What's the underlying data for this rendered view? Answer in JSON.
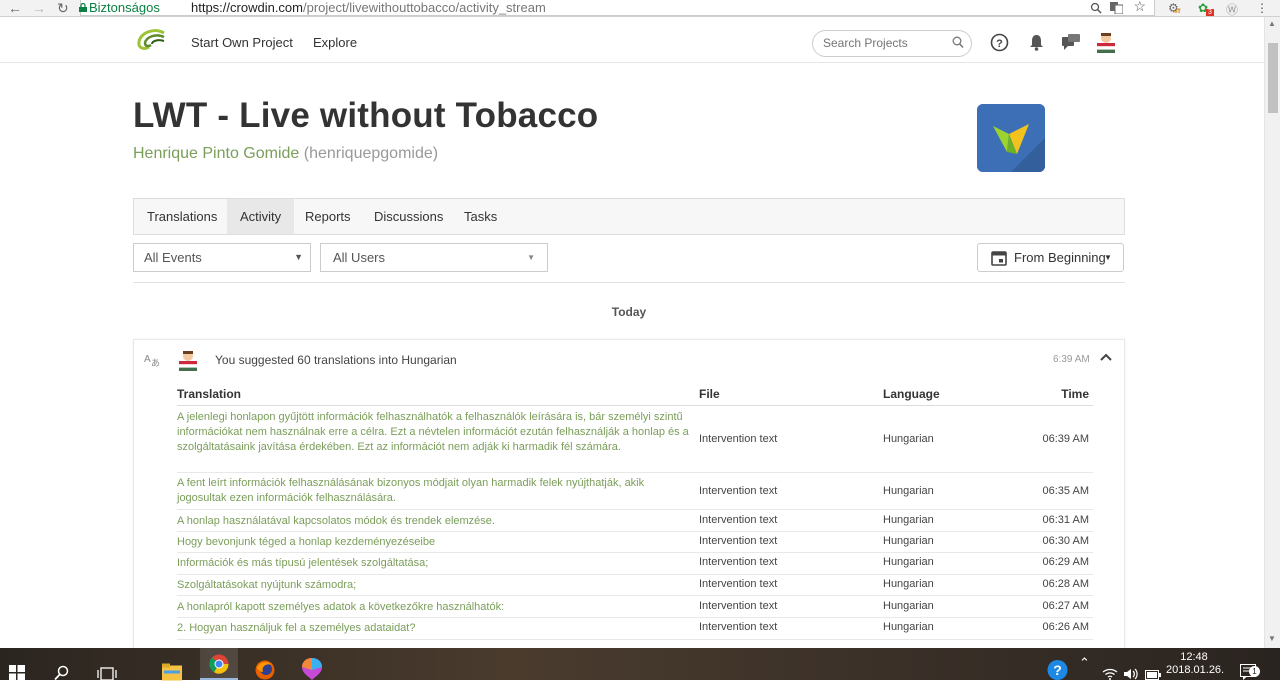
{
  "browser": {
    "back": "←",
    "forward": "→",
    "reload": "↻",
    "secure_label": "Biztonságos",
    "url_host": "https://crowdin.com",
    "url_path": "/project/livewithouttobacco/activity_stream",
    "ext_off": "off",
    "ext_badge": "3"
  },
  "header": {
    "nav": [
      "Start Own Project",
      "Explore"
    ],
    "search_placeholder": "Search Projects"
  },
  "project": {
    "title": "LWT - Live without Tobacco",
    "owner_name": "Henrique Pinto Gomide",
    "owner_login": "(henriquepgomide)"
  },
  "tabs": [
    "Translations",
    "Activity",
    "Reports",
    "Discussions",
    "Tasks"
  ],
  "active_tab": "Activity",
  "filters": {
    "events": "All Events",
    "users": "All Users",
    "date": "From Beginning"
  },
  "day_heading": "Today",
  "event": {
    "text": "You suggested 60 translations into Hungarian",
    "time": "6:39 AM"
  },
  "table": {
    "headers": [
      "Translation",
      "File",
      "Language",
      "Time"
    ],
    "rows": [
      {
        "translation": "A jelenlegi honlapon gyűjtött információk felhasználhatók a felhasználók leírására is, bár személyi szintű információkat nem használnak erre a célra. Ezt a névtelen információt ezután felhasználják a honlap és a szolgáltatásaink javítása érdekében. Ezt az információt nem adják ki harmadik fél számára.",
        "file": "Intervention text",
        "language": "Hungarian",
        "time": "06:39 AM"
      },
      {
        "translation": "A fent leírt információk felhasználásának bizonyos módjait olyan harmadik felek nyújthatják, akik jogosultak ezen információk felhasználására.",
        "file": "Intervention text",
        "language": "Hungarian",
        "time": "06:35 AM"
      },
      {
        "translation": "A honlap használatával kapcsolatos módok és trendek elemzése.",
        "file": "Intervention text",
        "language": "Hungarian",
        "time": "06:31 AM"
      },
      {
        "translation": "Hogy bevonjunk téged a honlap kezdeményezéseibe",
        "file": "Intervention text",
        "language": "Hungarian",
        "time": "06:30 AM"
      },
      {
        "translation": "Információk és más típusú jelentések szolgáltatása;",
        "file": "Intervention text",
        "language": "Hungarian",
        "time": "06:29 AM"
      },
      {
        "translation": "Szolgáltatásokat nyújtunk számodra;",
        "file": "Intervention text",
        "language": "Hungarian",
        "time": "06:28 AM"
      },
      {
        "translation": "A honlapról kapott személyes adatok a következőkre használhatók:",
        "file": "Intervention text",
        "language": "Hungarian",
        "time": "06:27 AM"
      },
      {
        "translation": "2. Hogyan használjuk fel a személyes adataidat?",
        "file": "Intervention text",
        "language": "Hungarian",
        "time": "06:26 AM"
      }
    ]
  },
  "taskbar": {
    "time": "12:48",
    "date": "2018.01.26.",
    "notification_count": "1"
  },
  "colors": {
    "accent_green": "#7b9e5a",
    "project_logo_bg": "#3d6fb6",
    "secure_green": "#0b8043"
  }
}
